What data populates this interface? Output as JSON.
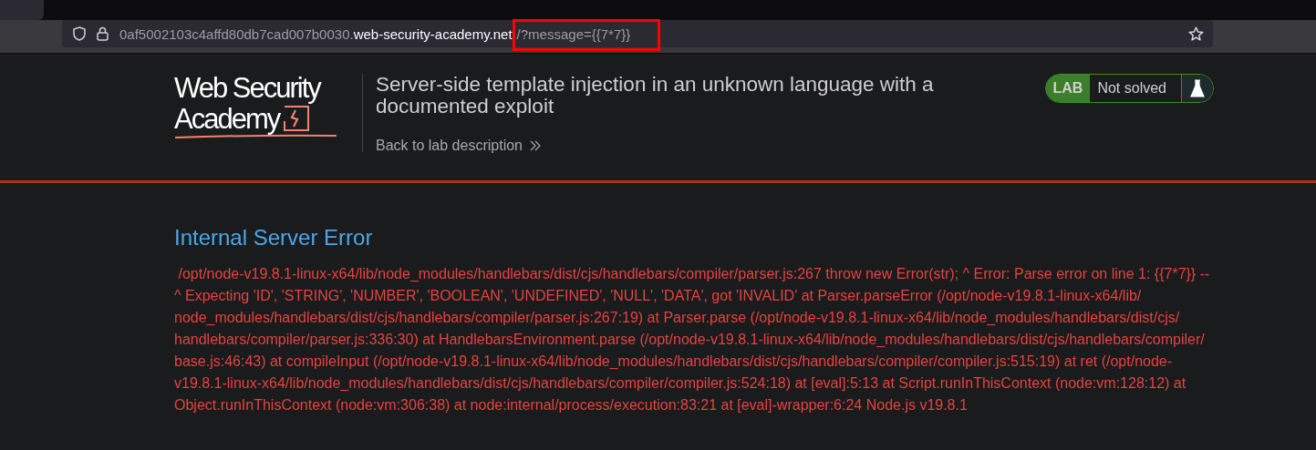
{
  "browser": {
    "url": {
      "prefix": "0af5002103c4affd80db7cad007b0030.",
      "domain": "web-security-academy.net",
      "path": "/?message={{7*7}}"
    }
  },
  "header": {
    "logo": {
      "line_1": "Web Security",
      "line_2": "Academy"
    },
    "title": "Server-side template injection in an unknown language with a documented exploit",
    "back_link": "Back to lab description",
    "lab_status": {
      "label": "LAB",
      "status": "Not solved",
      "solved": false
    }
  },
  "error": {
    "heading": "Internal Server Error",
    "message": " /opt/node-v19.8.1-linux-x64/lib/node_modules/handlebars/dist/cjs/handlebars/compiler/parser.js:267 throw new Error(str); ^ Error: Parse error on line 1: {{7*7}} -- ^ Expecting 'ID', 'STRING', 'NUMBER', 'BOOLEAN', 'UNDEFINED', 'NULL', 'DATA', got 'INVALID' at Parser.parseError (/opt/node-v19.8.1-linux-x64/lib/node_modules/handlebars/dist/cjs/handlebars/compiler/parser.js:267:19) at Parser.parse (/opt/node-v19.8.1-linux-x64/lib/node_modules/handlebars/dist/cjs/handlebars/compiler/parser.js:336:30) at HandlebarsEnvironment.parse (/opt/node-v19.8.1-linux-x64/lib/node_modules/handlebars/dist/cjs/handlebars/compiler/base.js:46:43) at compileInput (/opt/node-v19.8.1-linux-x64/lib/node_modules/handlebars/dist/cjs/handlebars/compiler/compiler.js:515:19) at ret (/opt/node-v19.8.1-linux-x64/lib/node_modules/handlebars/dist/cjs/handlebars/compiler/compiler.js:524:18) at [eval]:5:13 at Script.runInThisContext (node:vm:128:12) at Object.runInThisContext (node:vm:306:38) at node:internal/process/execution:83:21 at [eval]-wrapper:6:24 Node.js v19.8.1"
  }
}
